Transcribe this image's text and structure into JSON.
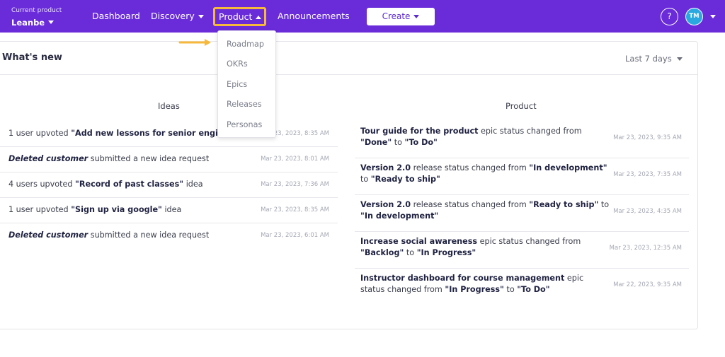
{
  "topbar": {
    "product_selector": {
      "caption": "Current product",
      "name": "Leanbe"
    },
    "nav": {
      "dashboard": "Dashboard",
      "discovery": "Discovery",
      "product": "Product",
      "announcements": "Announcements"
    },
    "create_label": "Create",
    "help_label": "?",
    "avatar_initials": "TM"
  },
  "product_menu": {
    "items": [
      {
        "label": "Roadmap"
      },
      {
        "label": "OKRs"
      },
      {
        "label": "Epics"
      },
      {
        "label": "Releases"
      },
      {
        "label": "Personas"
      }
    ]
  },
  "panel": {
    "title": "What's new",
    "range": "Last 7 days",
    "ideas": {
      "title": "Ideas",
      "rows": [
        {
          "pre": "1 user upvoted ",
          "bold": "\"Add new lessons for senior engineers\"",
          "post": "",
          "date": "Mar 23, 2023, 8:35 AM"
        },
        {
          "pre": "",
          "bold": "Deleted customer",
          "post": " submitted a new idea request",
          "date": "Mar 23, 2023, 8:01 AM"
        },
        {
          "pre": "4 users upvoted ",
          "bold": "\"Record of past classes\"",
          "post": " idea",
          "date": "Mar 23, 2023, 7:36 AM"
        },
        {
          "pre": "1 user upvoted ",
          "bold": "\"Sign up via google\"",
          "post": " idea",
          "date": "Mar 23, 2023, 8:35 AM"
        },
        {
          "pre": "",
          "bold": "Deleted customer",
          "post": " submitted a new idea request",
          "date": "Mar 23, 2023, 6:01 AM"
        }
      ]
    },
    "product": {
      "title": "Product",
      "rows": [
        {
          "t1": "Tour guide for the product",
          "t2": " epic status changed from ",
          "t3": "\"Done\"",
          "t4": " to ",
          "t5": "\"To Do\"",
          "date": "Mar 23, 2023, 9:35 AM"
        },
        {
          "t1": "Version 2.0",
          "t2": " release status changed from ",
          "t3": "\"In development\"",
          "t4": " to ",
          "t5": "\"Ready to ship\"",
          "date": "Mar 23, 2023, 7:35 AM"
        },
        {
          "t1": "Version 2.0",
          "t2": " release status changed from ",
          "t3": "\"Ready to ship\"",
          "t4": " to ",
          "t5": "\"In development\"",
          "date": "Mar 23, 2023, 4:35 AM"
        },
        {
          "t1": "Increase social awareness",
          "t2": " epic status changed from ",
          "t3": "\"Backlog\"",
          "t4": " to ",
          "t5": "\"In Progress\"",
          "date": "Mar 23, 2023, 12:35 AM"
        },
        {
          "t1": "Instructor dashboard for course management",
          "t2": " epic status changed from ",
          "t3": "\"In Progress\"",
          "t4": " to ",
          "t5": "\"To Do\"",
          "date": "Mar 22, 2023, 9:35 AM"
        }
      ]
    }
  },
  "colors": {
    "brand": "#6a2bd9",
    "highlight": "#f6b93b",
    "avatar": "#29a9e0"
  },
  "icons": [
    "chevron-down-icon",
    "chevron-up-icon",
    "help-icon",
    "arrow-right-icon"
  ]
}
